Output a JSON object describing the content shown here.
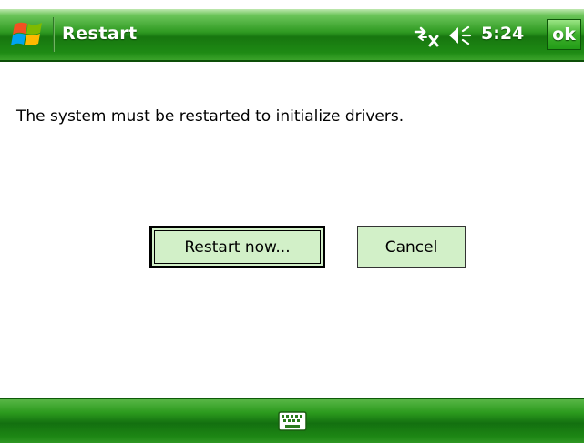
{
  "titlebar": {
    "start_icon": "windows-flag-icon",
    "title": "Restart",
    "connectivity_icon": "connectivity-off-icon",
    "volume_icon": "volume-icon",
    "clock": "5:24",
    "ok_label": "ok"
  },
  "content": {
    "message": "The system must be restarted to initialize drivers.",
    "restart_label": "Restart now...",
    "cancel_label": "Cancel"
  },
  "bottombar": {
    "keyboard_icon": "keyboard-icon"
  },
  "colors": {
    "titlebar_green": "#1e8a14",
    "button_fill": "#d2f0c8",
    "text": "#000000"
  }
}
